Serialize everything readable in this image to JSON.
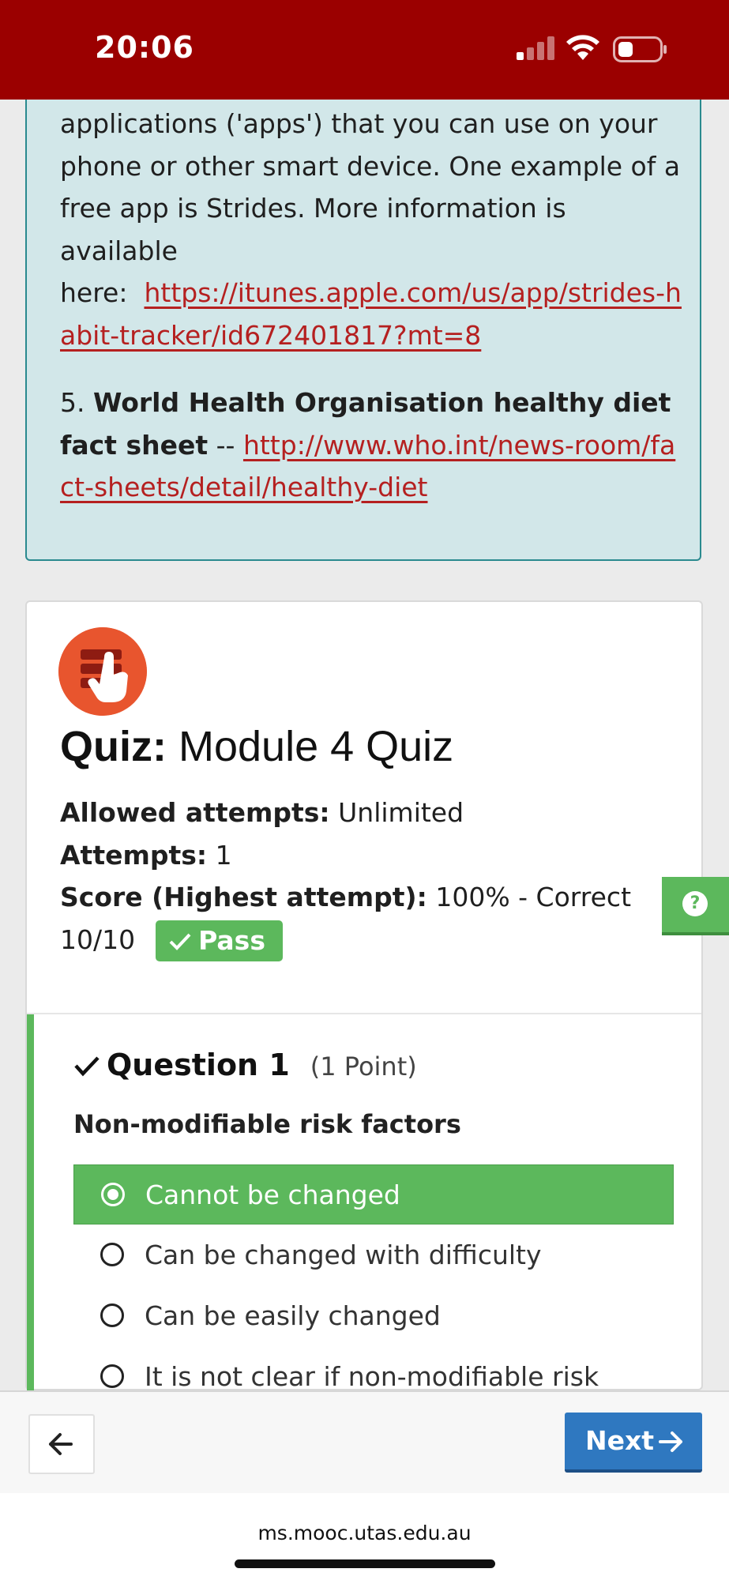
{
  "status_bar": {
    "time": "20:06"
  },
  "info_panel": {
    "paragraph_lines": "applications ('apps') that you can use on your phone or other smart device. One example of a free app is Strides. More information is available",
    "here_label": "here:",
    "strides_link": "https://itunes.apple.com/us/app/strides-habit-tracker/id672401817?mt=8",
    "item5_number": "5.",
    "item5_title": "World Health Organisation healthy diet fact sheet",
    "item5_separator": "--",
    "who_link": "http://www.who.int/news-room/fact-sheets/detail/healthy-diet"
  },
  "quiz": {
    "title_prefix": "Quiz:",
    "title": "Module 4 Quiz",
    "allowed_label": "Allowed attempts:",
    "allowed_value": "Unlimited",
    "attempts_label": "Attempts:",
    "attempts_value": "1",
    "score_label": "Score (Highest attempt):",
    "score_value": "100% - Correct 10/10",
    "pass_badge": "Pass"
  },
  "question": {
    "heading": "Question 1",
    "points": "(1 Point)",
    "text": "Non-modifiable risk factors",
    "options": [
      {
        "label": "Cannot be changed",
        "selected": true
      },
      {
        "label": "Can be changed with difficulty",
        "selected": false
      },
      {
        "label": "Can be easily changed",
        "selected": false
      },
      {
        "label": "It is not clear if non-modifiable risk",
        "selected": false
      }
    ]
  },
  "nav": {
    "next_label": "Next"
  },
  "browser": {
    "url": "ms.mooc.utas.edu.au"
  },
  "colors": {
    "status_bar": "#9b0000",
    "info_bg": "#d2e7e9",
    "link": "#b52020",
    "success": "#5cb85c",
    "primary": "#2f78c0",
    "logo": "#e8552e"
  },
  "icons": [
    "signal-icon",
    "wifi-icon",
    "battery-icon",
    "quiz-hand-icon",
    "check-icon",
    "help-icon",
    "arrow-left-icon",
    "arrow-right-icon"
  ]
}
